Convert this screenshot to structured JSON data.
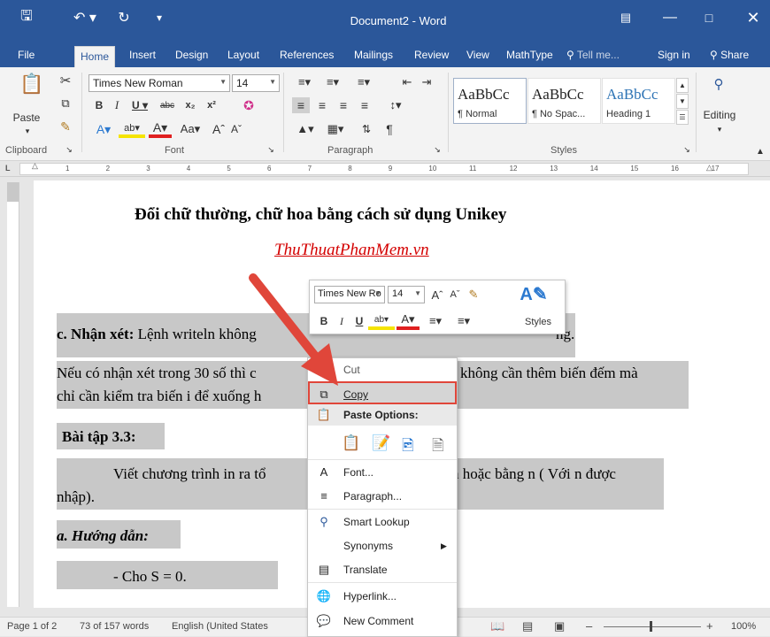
{
  "titlebar": {
    "title": "Document2 - Word"
  },
  "tabs": [
    "File",
    "Home",
    "Insert",
    "Design",
    "Layout",
    "References",
    "Mailings",
    "Review",
    "View",
    "MathType"
  ],
  "tell_me": "Tell me...",
  "sign_in": "Sign in",
  "share": "Share",
  "ribbon": {
    "font_name": "Times New Roman",
    "font_size": "14",
    "paste_label": "Paste",
    "groups": {
      "clipboard": "Clipboard",
      "font": "Font",
      "paragraph": "Paragraph",
      "styles": "Styles"
    },
    "styles": [
      {
        "sample": "AaBbCc",
        "name": "¶ Normal"
      },
      {
        "sample": "AaBbCc",
        "name": "¶ No Spac..."
      },
      {
        "sample": "AaBbCc",
        "name": "Heading 1"
      }
    ],
    "editing": "Editing"
  },
  "ruler_numbers": [
    "1",
    "2",
    "3",
    "4",
    "5",
    "6",
    "7",
    "8",
    "9",
    "10",
    "11",
    "12",
    "13",
    "14",
    "15",
    "16",
    "17"
  ],
  "document": {
    "title": "Đổi chữ thường, chữ hoa bằng cách sử dụng Unikey",
    "subtitle": "ThuThuatPhanMem.vn",
    "p1_bold": "c. Nhận xét:",
    "p1_text": " Lệnh writeln không",
    "p1_tail": "ng.",
    "p2_a": "Nếu có nhận xét trong 30 số thì c",
    "p2_b": " không cần thêm biến đếm mà",
    "p3": "chỉ cần kiểm tra biến i để xuống h",
    "bt": "Bài tập 3.3:",
    "p4_a": "Viết chương trình in ra tổ",
    "p4_b": "n hoặc bằng n ( Với n được",
    "p5": "nhập).",
    "guide": "a. Hướng dẫn:",
    "p6": "- Cho S = 0."
  },
  "mini_toolbar": {
    "font": "Times New Ro",
    "size": "14",
    "styles": "Styles"
  },
  "context_menu": {
    "cut": "Cut",
    "copy": "Copy",
    "paste_options": "Paste Options:",
    "font": "Font...",
    "paragraph": "Paragraph...",
    "smart_lookup": "Smart Lookup",
    "synonyms": "Synonyms",
    "translate": "Translate",
    "hyperlink": "Hyperlink...",
    "new_comment": "New Comment"
  },
  "status": {
    "page": "Page 1 of 2",
    "words": "73 of 157 words",
    "lang": "English (United States",
    "zoom": "100%"
  },
  "colors": {
    "word_blue": "#2b579a",
    "highlight": "#c8c8c8",
    "arrow": "#e0463a",
    "link": "#d40000"
  }
}
